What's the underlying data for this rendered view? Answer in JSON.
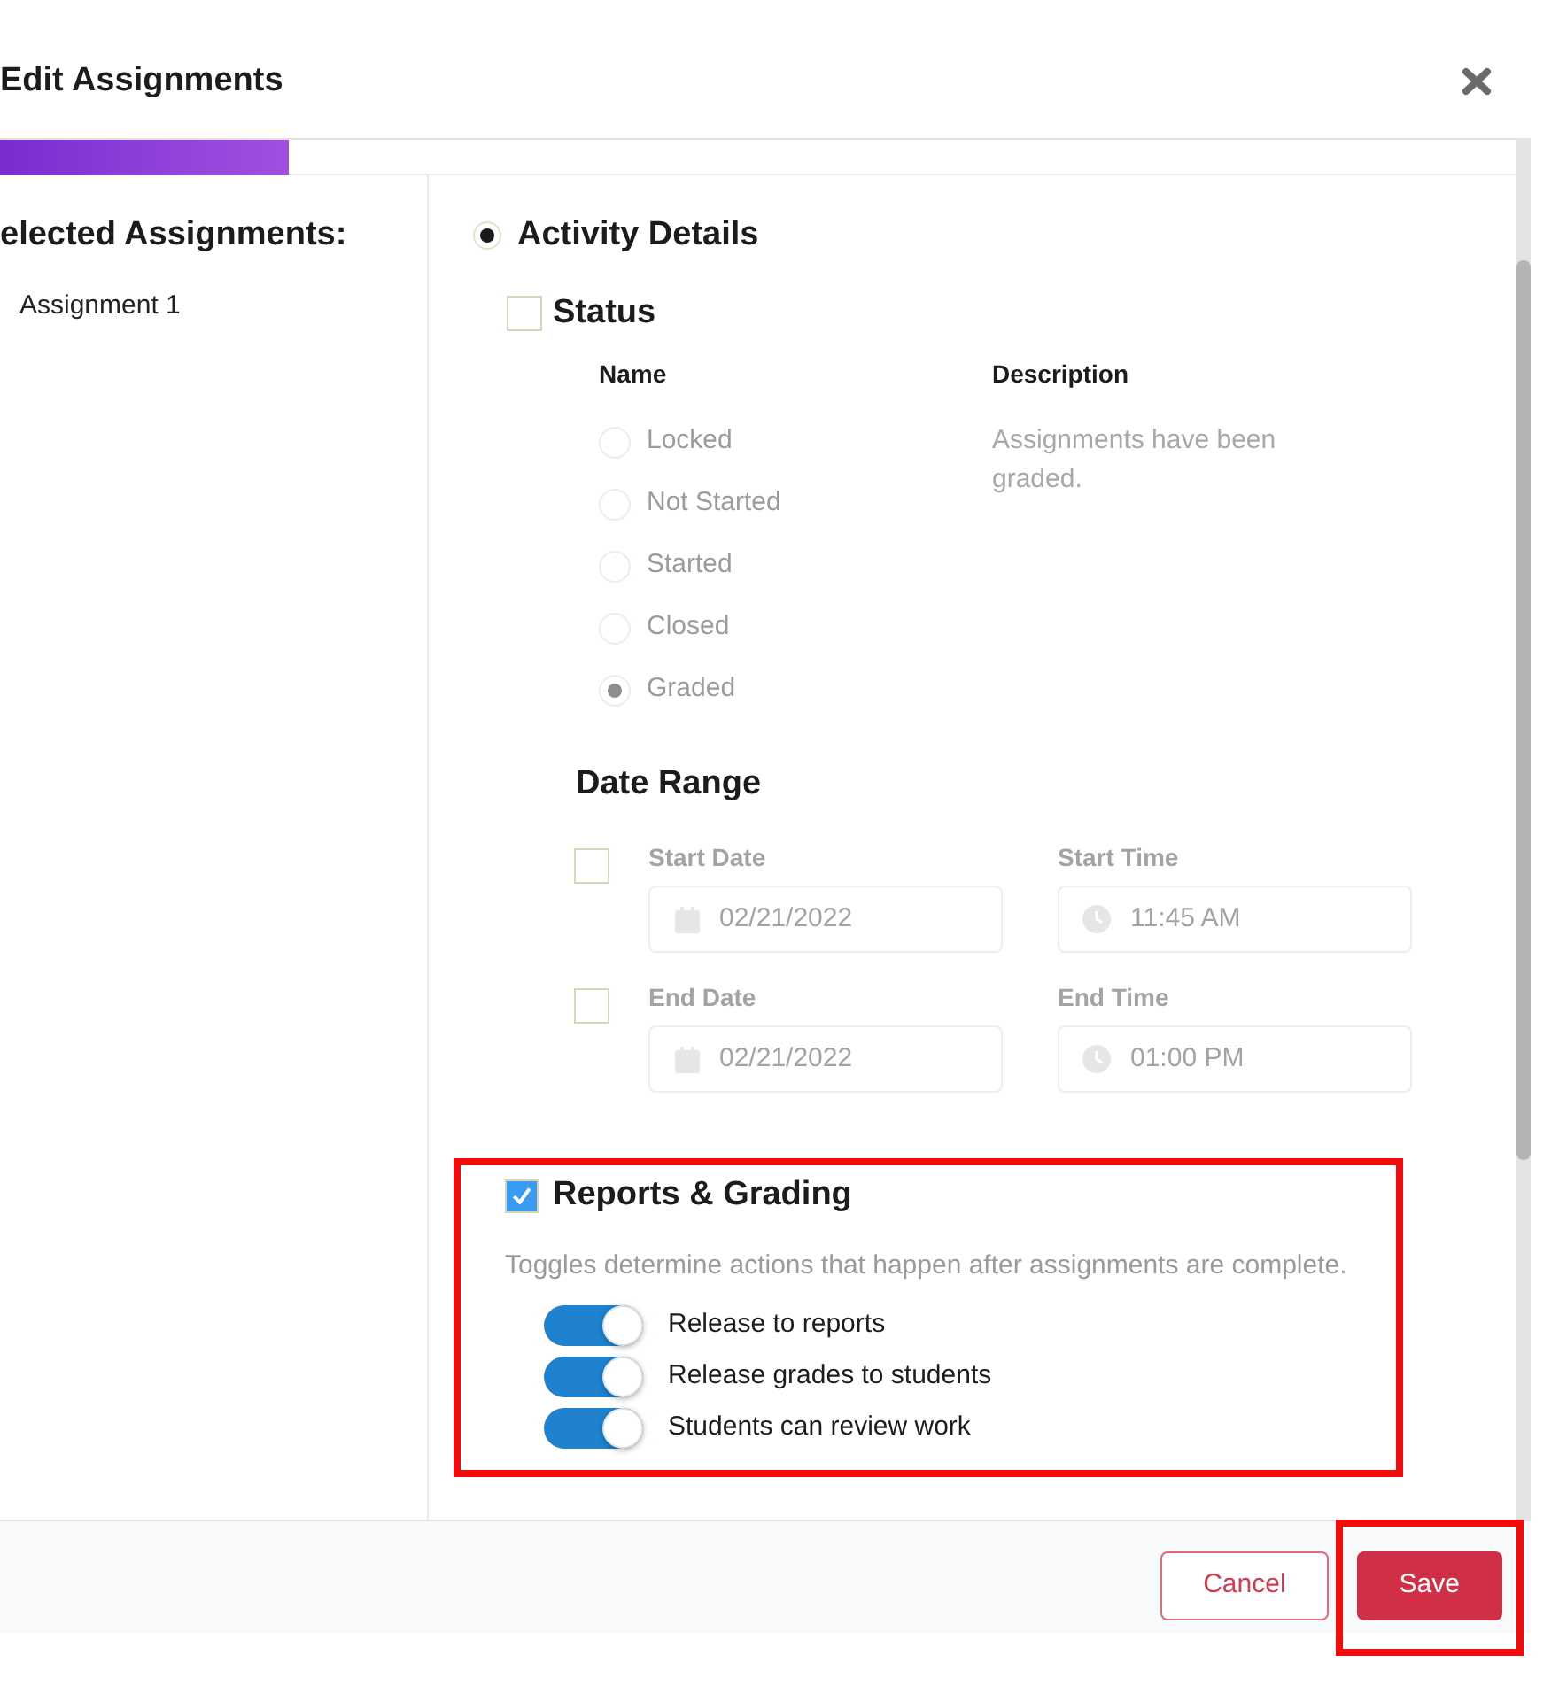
{
  "header": {
    "title": "Edit Assignments"
  },
  "sidebar": {
    "heading": "elected Assignments:",
    "items": [
      {
        "label": "Assignment 1"
      }
    ]
  },
  "activity": {
    "label": "Activity Details",
    "selected": true
  },
  "status": {
    "label": "Status",
    "checked": false,
    "columns": [
      "Name",
      "Description"
    ],
    "options": [
      {
        "label": "Locked",
        "selected": false,
        "disabled": true
      },
      {
        "label": "Not Started",
        "selected": false,
        "disabled": true
      },
      {
        "label": "Started",
        "selected": false,
        "disabled": true
      },
      {
        "label": "Closed",
        "selected": false,
        "disabled": true
      },
      {
        "label": "Graded",
        "selected": true,
        "disabled": true
      }
    ],
    "description": "Assignments have been graded."
  },
  "date_range": {
    "heading": "Date Range",
    "rows": [
      {
        "checked": false,
        "disabled": true,
        "date_label": "Start Date",
        "date_value": "02/21/2022",
        "time_label": "Start Time",
        "time_value": "11:45 AM"
      },
      {
        "checked": false,
        "disabled": true,
        "date_label": "End Date",
        "date_value": "02/21/2022",
        "time_label": "End Time",
        "time_value": "01:00 PM"
      }
    ]
  },
  "reports": {
    "label": "Reports & Grading",
    "checked": true,
    "highlighted": true,
    "hint": "Toggles determine actions that happen after assignments are complete.",
    "toggles": [
      {
        "label": "Release to reports",
        "on": true
      },
      {
        "label": "Release grades to students",
        "on": true
      },
      {
        "label": "Students can review work",
        "on": true
      }
    ]
  },
  "footer": {
    "buttons": [
      {
        "label": "Cancel",
        "kind": "secondary"
      },
      {
        "label": "Save",
        "kind": "primary",
        "highlighted": true
      }
    ]
  }
}
